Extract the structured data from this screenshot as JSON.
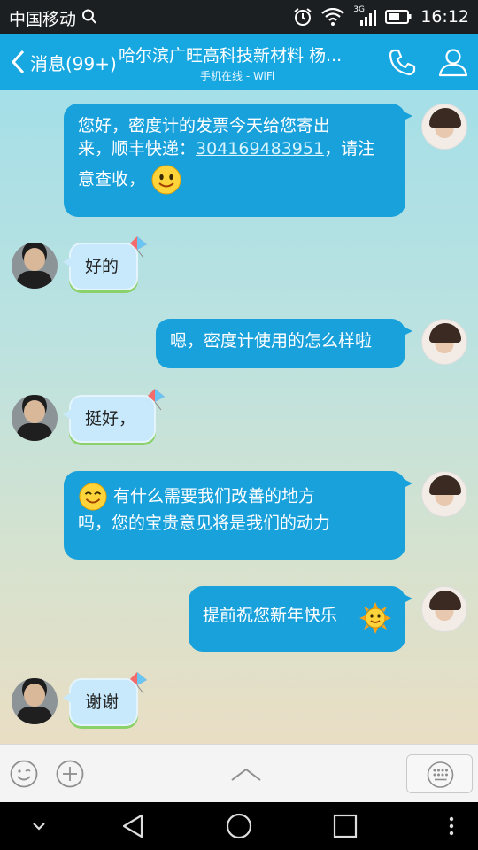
{
  "status_bar": {
    "carrier": "中国移动",
    "network": "3G",
    "time": "16:12"
  },
  "header": {
    "back_label": "消息(99+)",
    "title": "哈尔滨广旺高科技新材料 杨...",
    "subtitle": "手机在线 - WiFi"
  },
  "messages": [
    {
      "side": "out",
      "lines": [
        "您好，密度计的发票今天给您寄出",
        "来，顺丰快递：",
        "304169483951",
        "，请注",
        "意查收，"
      ],
      "emoji": "smile-emoji"
    },
    {
      "side": "in",
      "text": "好的"
    },
    {
      "side": "out",
      "text": "嗯，密度计使用的怎么样啦"
    },
    {
      "side": "in",
      "text": "挺好，"
    },
    {
      "side": "out",
      "line1": "有什么需要我们改善的地方",
      "line2": "吗，您的宝贵意见将是我们的动力",
      "emoji": "grin-emoji"
    },
    {
      "side": "out",
      "text": "提前祝您新年快乐",
      "emoji": "sun-emoji"
    },
    {
      "side": "in",
      "text": "谢谢"
    }
  ],
  "colors": {
    "header_blue": "#17a8e2",
    "outgoing_bubble": "#19a1dc",
    "incoming_bubble": "#c7e9fb"
  }
}
